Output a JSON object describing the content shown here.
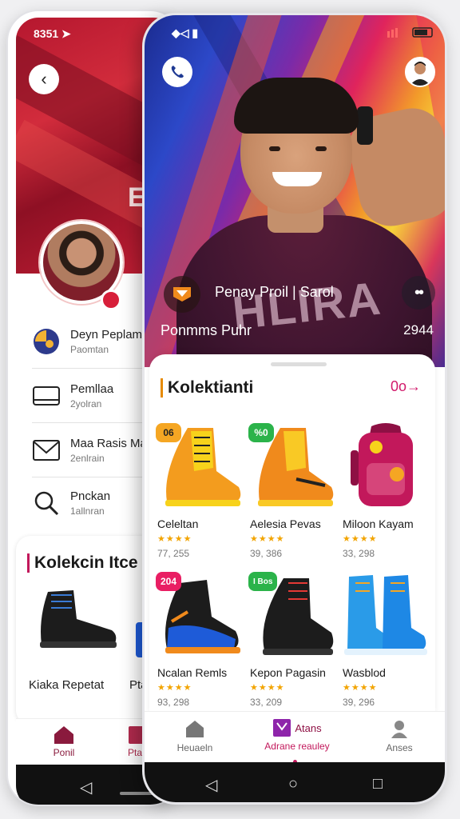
{
  "back_screen": {
    "status_time": "8351",
    "hero_text": "Ea",
    "profile_items": [
      {
        "title": "Deyn Peplam",
        "subtitle": "Paomtan",
        "icon": "globe-icon"
      },
      {
        "title": "Pemllaa",
        "subtitle": "2yolran",
        "icon": "card-icon"
      },
      {
        "title": "Maa Rasis Ma",
        "subtitle": "2enlrain",
        "icon": "mail-icon"
      },
      {
        "title": "Pnckan",
        "subtitle": "1allnran",
        "icon": "search-icon"
      }
    ],
    "collection_title": "Kolekcin Itce",
    "products": [
      {
        "name": "Kiaka Repetat"
      },
      {
        "name": "Ptar"
      }
    ],
    "nav": {
      "home_label": "Ponil",
      "second_label": "Ptao"
    }
  },
  "front_screen": {
    "status_icons": "◆◁ ▮",
    "hero": {
      "name": "Penay Proil | Sarol",
      "subtitle": "Ponmms Puhr",
      "count": "2944",
      "shirt_text": "HLIRA",
      "more_label": "••"
    },
    "collection": {
      "title": "Kolektianti",
      "more_link": "0o→"
    },
    "products": [
      {
        "name": "Celeltan",
        "badge": "06",
        "badge_color": "#f5a623",
        "rating": "★★★★",
        "price": "77, 255",
        "color": "#f39c1e",
        "accent": "#f7d21b"
      },
      {
        "name": "Aelesia Pevas",
        "badge": "%0",
        "badge_color": "#2bb34a",
        "rating": "★★★★",
        "price": "39, 386",
        "color": "#f08a1c",
        "accent": "#f9c925"
      },
      {
        "name": "Miloon Kayam",
        "badge": "",
        "badge_color": "",
        "rating": "★★★★",
        "price": "33, 298",
        "color": "#c2185b",
        "accent": "#8e1044"
      },
      {
        "name": "Ncalan Remls",
        "badge": "204",
        "badge_color": "#e91e63",
        "rating": "★★★★",
        "price": "93, 298",
        "color": "#1e5bd8",
        "accent": "#f08a1c"
      },
      {
        "name": "Kepon Pagasin",
        "badge": "I Bos",
        "badge_color": "#2bb34a",
        "rating": "★★★★",
        "price": "33, 209",
        "color": "#1c1c1c",
        "accent": "#e53935"
      },
      {
        "name": "Wasblod",
        "badge": "",
        "badge_color": "",
        "rating": "★★★★",
        "price": "39, 296",
        "color": "#2a9be8",
        "accent": "#f5a623"
      }
    ],
    "nav": [
      {
        "label": "Heuaeln",
        "icon": "home-icon"
      },
      {
        "label": "Adrane reauley",
        "icon": "shop-icon",
        "badge_text": "Atans"
      },
      {
        "label": "Anses",
        "icon": "profile-icon"
      }
    ]
  },
  "colors": {
    "brand": "#c2185b",
    "accent_orange": "#e68a00",
    "star": "#f2a400"
  }
}
